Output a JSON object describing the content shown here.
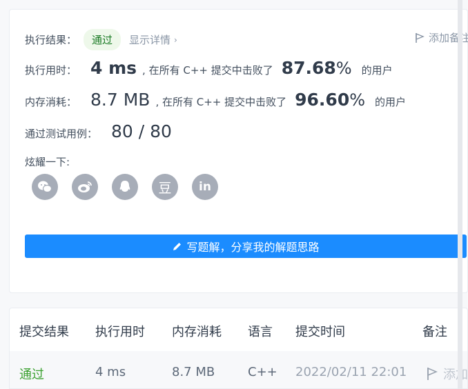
{
  "result": {
    "label": "执行结果：",
    "status": "通过",
    "detail_link": "显示详情",
    "add_note": "添加备注"
  },
  "runtime": {
    "label": "执行用时：",
    "value": "4 ms",
    "note": ", 在所有 C++ 提交中击败了",
    "percent": "87.68",
    "percent_sign": "%",
    "suffix": "的用户"
  },
  "memory": {
    "label": "内存消耗：",
    "value": "8.7 MB",
    "note": ", 在所有 C++ 提交中击败了",
    "percent": "96.60",
    "percent_sign": "%",
    "suffix": "的用户"
  },
  "tests": {
    "label": "通过测试用例：",
    "value": "80 / 80"
  },
  "share": {
    "label": "炫耀一下:",
    "icons": [
      "wechat-icon",
      "weibo-icon",
      "qq-icon",
      "douban-icon",
      "linkedin-icon"
    ],
    "douban_glyph": "豆",
    "linkedin_glyph": "in"
  },
  "write_button": "写题解，分享我的解题思路",
  "table": {
    "headers": [
      "提交结果",
      "执行用时",
      "内存消耗",
      "语言",
      "提交时间",
      "备注"
    ],
    "row": {
      "result": "通过",
      "runtime": "4 ms",
      "memory": "8.7 MB",
      "language": "C++",
      "time": "2022/02/11 22:01",
      "note": "添加备注"
    }
  },
  "colors": {
    "accent": "#1b8cff",
    "success": "#3aa02f",
    "icon_gray": "#a7adb8"
  }
}
